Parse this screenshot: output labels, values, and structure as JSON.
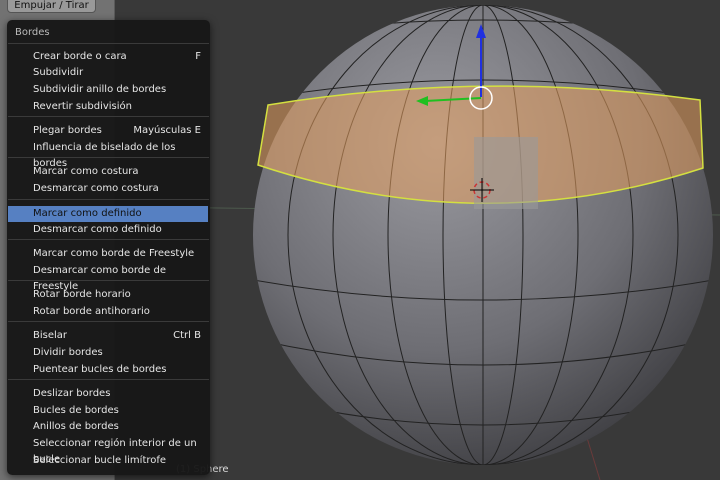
{
  "tool_panel": {
    "push_pull_label": "Empujar / Tirar"
  },
  "viewport": {
    "object_label": "(1) Sphere"
  },
  "menu": {
    "title": "Bordes",
    "items": [
      {
        "label": "Crear borde o cara",
        "shortcut": "F"
      },
      {
        "label": "Subdividir"
      },
      {
        "label": "Subdividir anillo de bordes"
      },
      {
        "label": "Revertir subdivisión"
      },
      {
        "label": "Plegar bordes",
        "shortcut": "Mayúsculas E"
      },
      {
        "label": "Influencia de biselado de los bordes"
      },
      {
        "label": "Marcar como costura"
      },
      {
        "label": "Desmarcar como costura"
      },
      {
        "label": "Marcar como definido",
        "highlighted": true
      },
      {
        "label": "Desmarcar como definido"
      },
      {
        "label": "Marcar como borde de Freestyle"
      },
      {
        "label": "Desmarcar como borde de Freestyle"
      },
      {
        "label": "Rotar borde horario"
      },
      {
        "label": "Rotar borde antihorario"
      },
      {
        "label": "Biselar",
        "shortcut": "Ctrl B"
      },
      {
        "label": "Dividir bordes"
      },
      {
        "label": "Puentear bucles de bordes"
      },
      {
        "label": "Deslizar bordes"
      },
      {
        "label": "Bucles de bordes"
      },
      {
        "label": "Anillos de bordes"
      },
      {
        "label": "Seleccionar región interior de un bucle"
      },
      {
        "label": "Seleccionar bucle limítrofe"
      }
    ]
  },
  "colors": {
    "highlight": "#5680c2",
    "selection": "#e8a060",
    "edge_sharp": "#d4e040"
  }
}
